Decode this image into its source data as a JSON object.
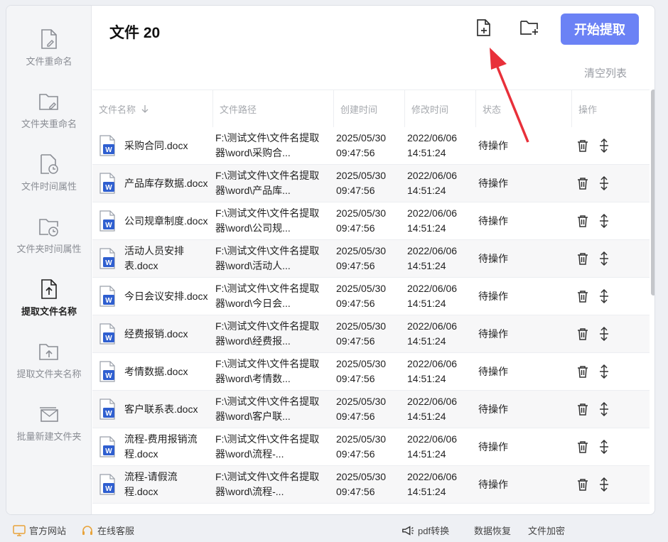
{
  "sidebar": {
    "items": [
      {
        "label": "文件重命名",
        "icon": "file-edit-icon"
      },
      {
        "label": "文件夹重命名",
        "icon": "folder-edit-icon"
      },
      {
        "label": "文件时间属性",
        "icon": "file-clock-icon"
      },
      {
        "label": "文件夹时间属性",
        "icon": "folder-clock-icon"
      },
      {
        "label": "提取文件名称",
        "icon": "file-upload-icon"
      },
      {
        "label": "提取文件夹名称",
        "icon": "folder-upload-icon"
      },
      {
        "label": "批量新建文件夹",
        "icon": "batch-folder-icon"
      }
    ],
    "active_index": 4
  },
  "header": {
    "title": "文件 20",
    "start_label": "开始提取",
    "clear_label": "清空列表"
  },
  "table": {
    "columns": [
      "文件名称",
      "文件路径",
      "创建时间",
      "修改时间",
      "状态",
      "操作"
    ],
    "rows": [
      {
        "name": "采购合同.docx",
        "path": "F:\\测试文件\\文件名提取器\\word\\采购合...",
        "ctime": "2025/05/30 09:47:56",
        "mtime": "2022/06/06 14:51:24",
        "status": "待操作"
      },
      {
        "name": "产品库存数据.docx",
        "path": "F:\\测试文件\\文件名提取器\\word\\产品库...",
        "ctime": "2025/05/30 09:47:56",
        "mtime": "2022/06/06 14:51:24",
        "status": "待操作"
      },
      {
        "name": "公司规章制度.docx",
        "path": "F:\\测试文件\\文件名提取器\\word\\公司规...",
        "ctime": "2025/05/30 09:47:56",
        "mtime": "2022/06/06 14:51:24",
        "status": "待操作"
      },
      {
        "name": "活动人员安排表.docx",
        "path": "F:\\测试文件\\文件名提取器\\word\\活动人...",
        "ctime": "2025/05/30 09:47:56",
        "mtime": "2022/06/06 14:51:24",
        "status": "待操作"
      },
      {
        "name": "今日会议安排.docx",
        "path": "F:\\测试文件\\文件名提取器\\word\\今日会...",
        "ctime": "2025/05/30 09:47:56",
        "mtime": "2022/06/06 14:51:24",
        "status": "待操作"
      },
      {
        "name": "经费报销.docx",
        "path": "F:\\测试文件\\文件名提取器\\word\\经费报...",
        "ctime": "2025/05/30 09:47:56",
        "mtime": "2022/06/06 14:51:24",
        "status": "待操作"
      },
      {
        "name": "考情数据.docx",
        "path": "F:\\测试文件\\文件名提取器\\word\\考情数...",
        "ctime": "2025/05/30 09:47:56",
        "mtime": "2022/06/06 14:51:24",
        "status": "待操作"
      },
      {
        "name": "客户联系表.docx",
        "path": "F:\\测试文件\\文件名提取器\\word\\客户联...",
        "ctime": "2025/05/30 09:47:56",
        "mtime": "2022/06/06 14:51:24",
        "status": "待操作"
      },
      {
        "name": "流程-费用报销流程.docx",
        "path": "F:\\测试文件\\文件名提取器\\word\\流程-...",
        "ctime": "2025/05/30 09:47:56",
        "mtime": "2022/06/06 14:51:24",
        "status": "待操作"
      },
      {
        "name": "流程-请假流程.docx",
        "path": "F:\\测试文件\\文件名提取器\\word\\流程-...",
        "ctime": "2025/05/30 09:47:56",
        "mtime": "2022/06/06 14:51:24",
        "status": "待操作"
      }
    ]
  },
  "footer": {
    "website": "官方网站",
    "support": "在线客服",
    "pdf": "pdf转换",
    "recover": "数据恢复",
    "encrypt": "文件加密"
  },
  "colors": {
    "accent": "#6b82f5",
    "arrow": "#e8303a",
    "word_icon": "#2f5fd0"
  }
}
